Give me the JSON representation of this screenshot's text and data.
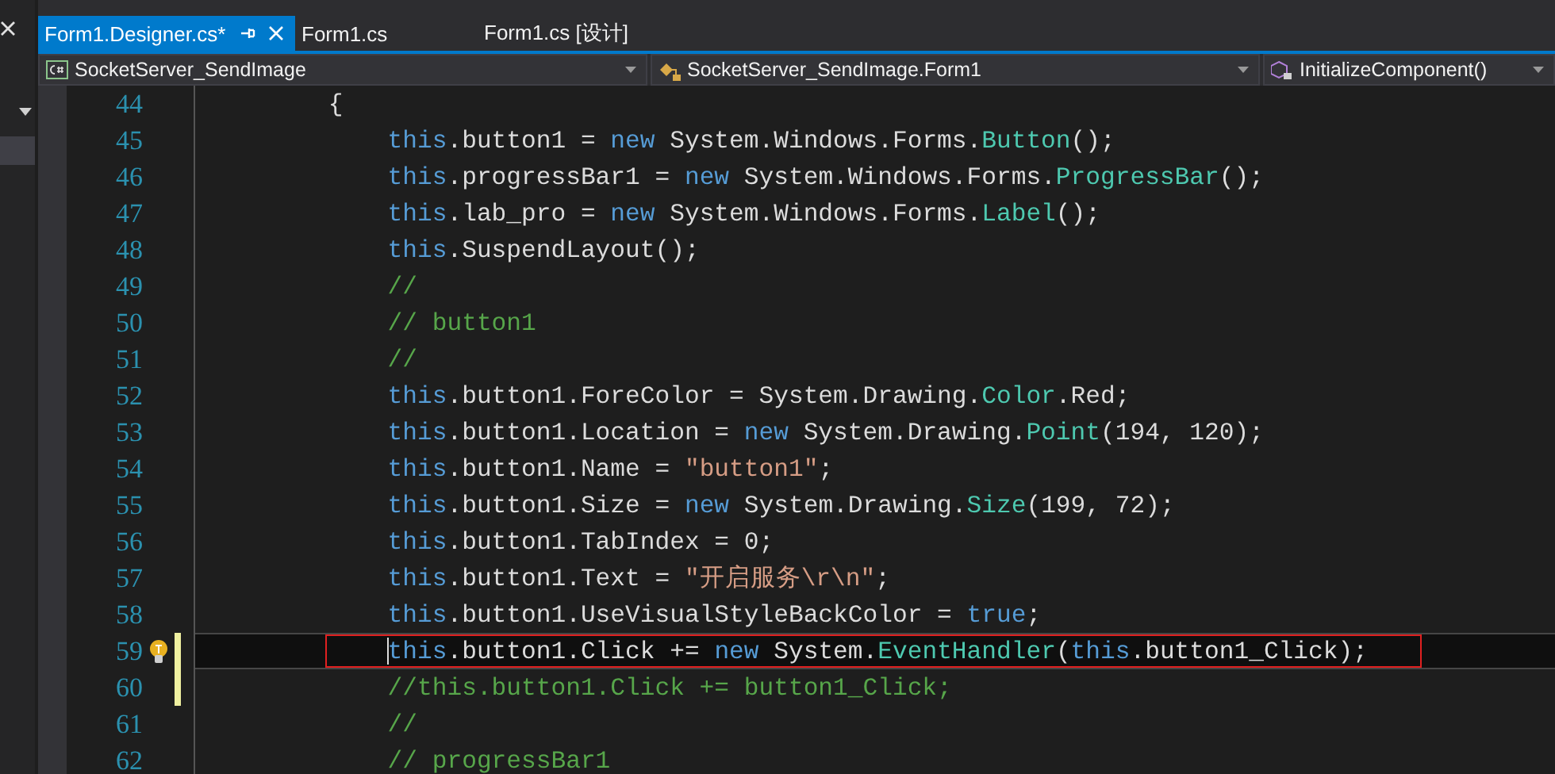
{
  "tabs": [
    {
      "label": "Form1.Designer.cs*",
      "selected": true
    },
    {
      "label": "Form1.cs",
      "selected": false
    },
    {
      "label": "Form1.cs [设计]",
      "selected": false
    }
  ],
  "navigation": [
    {
      "kind": "project",
      "text": "SocketServer_SendImage"
    },
    {
      "kind": "class",
      "text": "SocketServer_SendImage.Form1"
    },
    {
      "kind": "method",
      "text": "InitializeComponent()"
    }
  ],
  "editor": {
    "lines": [
      {
        "number": "44",
        "current": false,
        "changed": false,
        "lightbulb": false,
        "boxed": false,
        "tokens": [
          {
            "kind": "plain",
            "text": "        {"
          }
        ]
      },
      {
        "number": "45",
        "current": false,
        "changed": false,
        "lightbulb": false,
        "boxed": false,
        "tokens": [
          {
            "kind": "keyword",
            "text": "            this"
          },
          {
            "kind": "plain",
            "text": ".button1 = "
          },
          {
            "kind": "keyword",
            "text": "new"
          },
          {
            "kind": "plain",
            "text": " System.Windows.Forms."
          },
          {
            "kind": "type",
            "text": "Button"
          },
          {
            "kind": "plain",
            "text": "();"
          }
        ]
      },
      {
        "number": "46",
        "current": false,
        "changed": false,
        "lightbulb": false,
        "boxed": false,
        "tokens": [
          {
            "kind": "keyword",
            "text": "            this"
          },
          {
            "kind": "plain",
            "text": ".progressBar1 = "
          },
          {
            "kind": "keyword",
            "text": "new"
          },
          {
            "kind": "plain",
            "text": " System.Windows.Forms."
          },
          {
            "kind": "type",
            "text": "ProgressBar"
          },
          {
            "kind": "plain",
            "text": "();"
          }
        ]
      },
      {
        "number": "47",
        "current": false,
        "changed": false,
        "lightbulb": false,
        "boxed": false,
        "tokens": [
          {
            "kind": "keyword",
            "text": "            this"
          },
          {
            "kind": "plain",
            "text": ".lab_pro = "
          },
          {
            "kind": "keyword",
            "text": "new"
          },
          {
            "kind": "plain",
            "text": " System.Windows.Forms."
          },
          {
            "kind": "type",
            "text": "Label"
          },
          {
            "kind": "plain",
            "text": "();"
          }
        ]
      },
      {
        "number": "48",
        "current": false,
        "changed": false,
        "lightbulb": false,
        "boxed": false,
        "tokens": [
          {
            "kind": "keyword",
            "text": "            this"
          },
          {
            "kind": "plain",
            "text": ".SuspendLayout();"
          }
        ]
      },
      {
        "number": "49",
        "current": false,
        "changed": false,
        "lightbulb": false,
        "boxed": false,
        "tokens": [
          {
            "kind": "comment",
            "text": "            //"
          }
        ]
      },
      {
        "number": "50",
        "current": false,
        "changed": false,
        "lightbulb": false,
        "boxed": false,
        "tokens": [
          {
            "kind": "comment",
            "text": "            // button1"
          }
        ]
      },
      {
        "number": "51",
        "current": false,
        "changed": false,
        "lightbulb": false,
        "boxed": false,
        "tokens": [
          {
            "kind": "comment",
            "text": "            //"
          }
        ]
      },
      {
        "number": "52",
        "current": false,
        "changed": false,
        "lightbulb": false,
        "boxed": false,
        "tokens": [
          {
            "kind": "keyword",
            "text": "            this"
          },
          {
            "kind": "plain",
            "text": ".button1.ForeColor = System.Drawing."
          },
          {
            "kind": "type",
            "text": "Color"
          },
          {
            "kind": "plain",
            "text": ".Red;"
          }
        ]
      },
      {
        "number": "53",
        "current": false,
        "changed": false,
        "lightbulb": false,
        "boxed": false,
        "tokens": [
          {
            "kind": "keyword",
            "text": "            this"
          },
          {
            "kind": "plain",
            "text": ".button1.Location = "
          },
          {
            "kind": "keyword",
            "text": "new"
          },
          {
            "kind": "plain",
            "text": " System.Drawing."
          },
          {
            "kind": "type",
            "text": "Point"
          },
          {
            "kind": "plain",
            "text": "(194, 120);"
          }
        ]
      },
      {
        "number": "54",
        "current": false,
        "changed": false,
        "lightbulb": false,
        "boxed": false,
        "tokens": [
          {
            "kind": "keyword",
            "text": "            this"
          },
          {
            "kind": "plain",
            "text": ".button1.Name = "
          },
          {
            "kind": "string",
            "text": "\"button1\""
          },
          {
            "kind": "plain",
            "text": ";"
          }
        ]
      },
      {
        "number": "55",
        "current": false,
        "changed": false,
        "lightbulb": false,
        "boxed": false,
        "tokens": [
          {
            "kind": "keyword",
            "text": "            this"
          },
          {
            "kind": "plain",
            "text": ".button1.Size = "
          },
          {
            "kind": "keyword",
            "text": "new"
          },
          {
            "kind": "plain",
            "text": " System.Drawing."
          },
          {
            "kind": "type",
            "text": "Size"
          },
          {
            "kind": "plain",
            "text": "(199, 72);"
          }
        ]
      },
      {
        "number": "56",
        "current": false,
        "changed": false,
        "lightbulb": false,
        "boxed": false,
        "tokens": [
          {
            "kind": "keyword",
            "text": "            this"
          },
          {
            "kind": "plain",
            "text": ".button1.TabIndex = 0;"
          }
        ]
      },
      {
        "number": "57",
        "current": false,
        "changed": false,
        "lightbulb": false,
        "boxed": false,
        "tokens": [
          {
            "kind": "keyword",
            "text": "            this"
          },
          {
            "kind": "plain",
            "text": ".button1.Text = "
          },
          {
            "kind": "string",
            "text": "\"开启服务\\r\\n\""
          },
          {
            "kind": "plain",
            "text": ";"
          }
        ]
      },
      {
        "number": "58",
        "current": false,
        "changed": false,
        "lightbulb": false,
        "boxed": false,
        "tokens": [
          {
            "kind": "keyword",
            "text": "            this"
          },
          {
            "kind": "plain",
            "text": ".button1.UseVisualStyleBackColor = "
          },
          {
            "kind": "keyword",
            "text": "true"
          },
          {
            "kind": "plain",
            "text": ";"
          }
        ]
      },
      {
        "number": "59",
        "current": true,
        "changed": true,
        "lightbulb": true,
        "boxed": true,
        "tokens": [
          {
            "kind": "keyword",
            "text": "            this"
          },
          {
            "kind": "plain",
            "text": ".button1.Click += "
          },
          {
            "kind": "keyword",
            "text": "new"
          },
          {
            "kind": "plain",
            "text": " System."
          },
          {
            "kind": "type",
            "text": "EventHandler"
          },
          {
            "kind": "plain",
            "text": "("
          },
          {
            "kind": "keyword",
            "text": "this"
          },
          {
            "kind": "plain",
            "text": ".button1_Click);"
          }
        ]
      },
      {
        "number": "60",
        "current": false,
        "changed": true,
        "lightbulb": false,
        "boxed": false,
        "tokens": [
          {
            "kind": "comment",
            "text": "            //this.button1.Click += button1_Click;"
          }
        ]
      },
      {
        "number": "61",
        "current": false,
        "changed": false,
        "lightbulb": false,
        "boxed": false,
        "tokens": [
          {
            "kind": "comment",
            "text": "            //"
          }
        ]
      },
      {
        "number": "62",
        "current": false,
        "changed": false,
        "lightbulb": false,
        "boxed": false,
        "tokens": [
          {
            "kind": "comment",
            "text": "            // progressBar1"
          }
        ]
      }
    ]
  }
}
